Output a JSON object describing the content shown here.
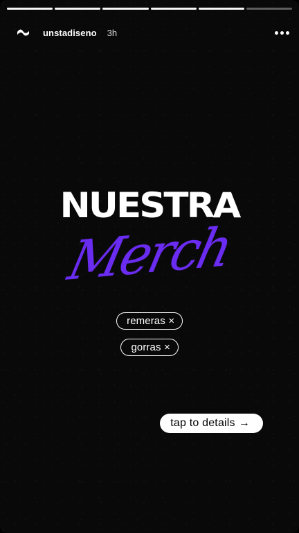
{
  "story": {
    "progress": [
      {
        "fill": 1
      },
      {
        "fill": 1
      },
      {
        "fill": 1
      },
      {
        "fill": 1
      },
      {
        "fill": 1
      },
      {
        "fill": 0
      }
    ],
    "author": {
      "logo_icon": "wave-logo-icon",
      "username": "unstadiseno",
      "time": "3h"
    },
    "more_icon": "more-options-icon"
  },
  "content": {
    "title": "NUESTRA",
    "script": "Merch",
    "script_color": "#6b2cf2",
    "tags": [
      {
        "label": "remeras",
        "remove_glyph": "×"
      },
      {
        "label": "gorras",
        "remove_glyph": "×"
      }
    ],
    "cta": {
      "label": "tap to details",
      "arrow_glyph": "→"
    }
  },
  "colors": {
    "background": "#090909",
    "text": "#ffffff",
    "accent": "#6b2cf2"
  }
}
